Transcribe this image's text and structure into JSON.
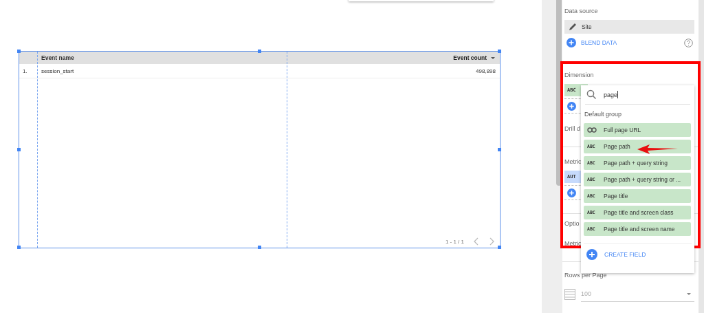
{
  "table": {
    "columns": [
      {
        "label": "Event name",
        "sorted": false
      },
      {
        "label": "Event count",
        "sorted": true
      }
    ],
    "rows": [
      {
        "index": "1.",
        "cells": [
          "session_start",
          "498,898"
        ]
      }
    ],
    "pagination": "1 - 1 / 1"
  },
  "panel": {
    "data_source_label": "Data source",
    "data_source": "Site",
    "blend_button": "BLEND DATA",
    "dimension_label": "Dimension",
    "dimension_chip": "ABC",
    "drill_label": "Drill d",
    "metric_label": "Metric",
    "metric_chip": "AUT",
    "optional_label": "Optio",
    "metric_sliders_label": "Metric",
    "rows_per_page_label": "Rows per Page",
    "rows_per_page": "100"
  },
  "field_picker": {
    "search_value": "page",
    "group": "Default group",
    "items": [
      {
        "kind": "link",
        "label": "Full page URL"
      },
      {
        "kind": "text",
        "badge": "ABC",
        "label": "Page path"
      },
      {
        "kind": "text",
        "badge": "ABC",
        "label": "Page path + query string"
      },
      {
        "kind": "text",
        "badge": "ABC",
        "label": "Page path + query string or ..."
      },
      {
        "kind": "text",
        "badge": "ABC",
        "label": "Page title"
      },
      {
        "kind": "text",
        "badge": "ABC",
        "label": "Page title and screen class"
      },
      {
        "kind": "text",
        "badge": "ABC",
        "label": "Page title and screen name"
      }
    ],
    "create_button": "CREATE FIELD"
  }
}
